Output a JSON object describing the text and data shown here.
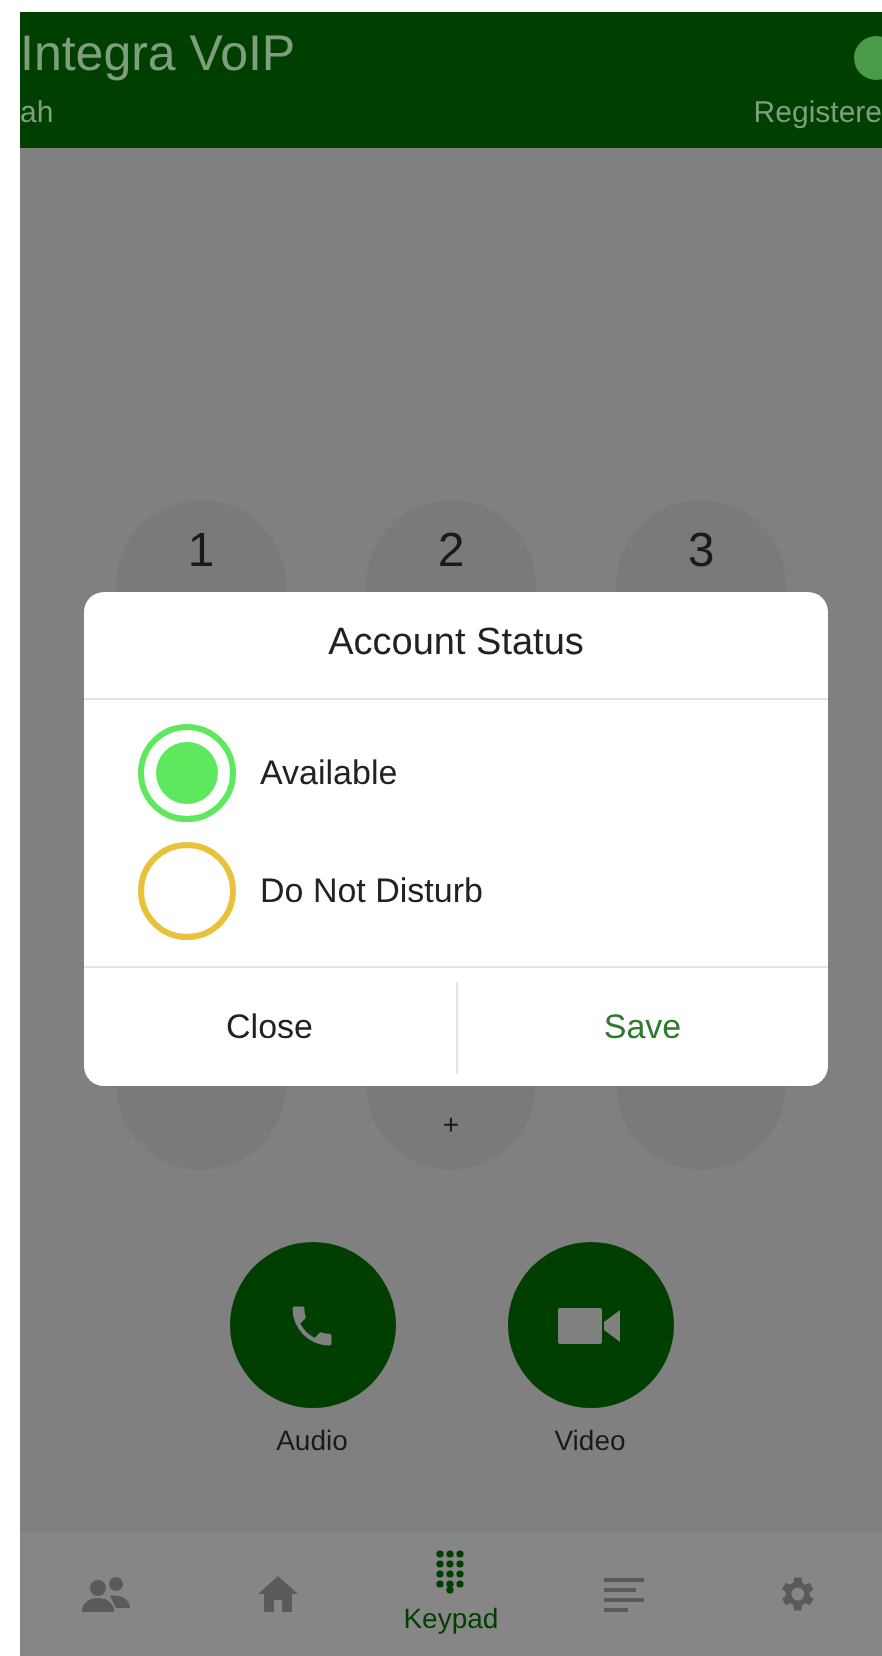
{
  "header": {
    "title": "Integra VoIP",
    "account": "ah",
    "status": "Registere"
  },
  "keypad": {
    "rows": [
      [
        {
          "digit": "1"
        },
        {
          "digit": "2"
        },
        {
          "digit": "3"
        }
      ],
      [
        {},
        {
          "digit": "+"
        },
        {}
      ]
    ]
  },
  "dialog": {
    "title": "Account Status",
    "options": [
      {
        "label": "Available",
        "selected": true,
        "color": "#5ee85e"
      },
      {
        "label": "Do Not Disturb",
        "selected": false,
        "color": "#e8c23a"
      }
    ],
    "buttons": [
      {
        "label": "Close",
        "kind": "cancel"
      },
      {
        "label": "Save",
        "kind": "confirm"
      }
    ]
  },
  "call_buttons": [
    {
      "label": "Audio",
      "kind": "audio"
    },
    {
      "label": "Video",
      "kind": "video"
    }
  ],
  "nav": [
    {
      "kind": "contacts",
      "selected": false
    },
    {
      "kind": "home",
      "selected": false
    },
    {
      "kind": "keypad",
      "label": "Keypad",
      "selected": true
    },
    {
      "kind": "history",
      "selected": false
    },
    {
      "kind": "settings",
      "selected": false
    }
  ]
}
